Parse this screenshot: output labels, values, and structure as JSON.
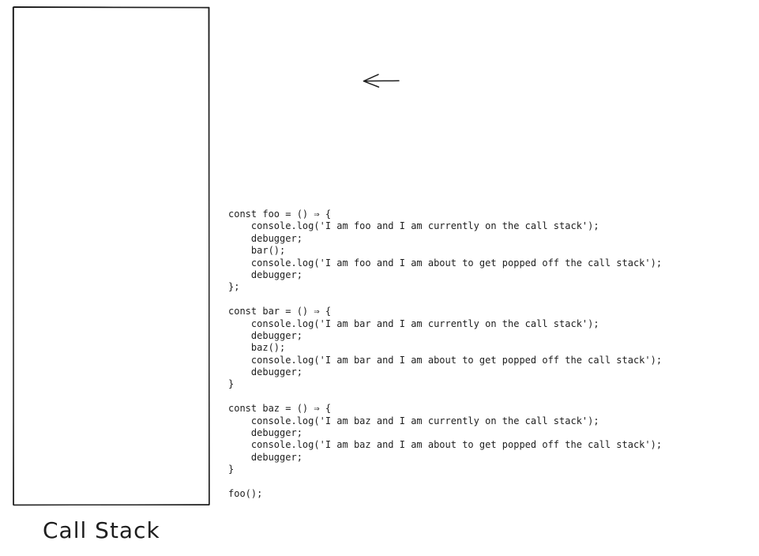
{
  "diagram": {
    "stack_label": "Call Stack",
    "stroke_color": "#1e1e1e",
    "background_color": "#ffffff",
    "pointer": "left-arrow-icon",
    "code_lines": [
      "const foo = () ⇒ {",
      "    console.log('I am foo and I am currently on the call stack');",
      "    debugger;",
      "    bar();",
      "    console.log('I am foo and I am about to get popped off the call stack');",
      "    debugger;",
      "};",
      "",
      "const bar = () ⇒ {",
      "    console.log('I am bar and I am currently on the call stack');",
      "    debugger;",
      "    baz();",
      "    console.log('I am bar and I am about to get popped off the call stack');",
      "    debugger;",
      "}",
      "",
      "const baz = () ⇒ {",
      "    console.log('I am baz and I am currently on the call stack');",
      "    debugger;",
      "    console.log('I am baz and I am about to get popped off the call stack');",
      "    debugger;",
      "}",
      "",
      "foo();"
    ]
  }
}
